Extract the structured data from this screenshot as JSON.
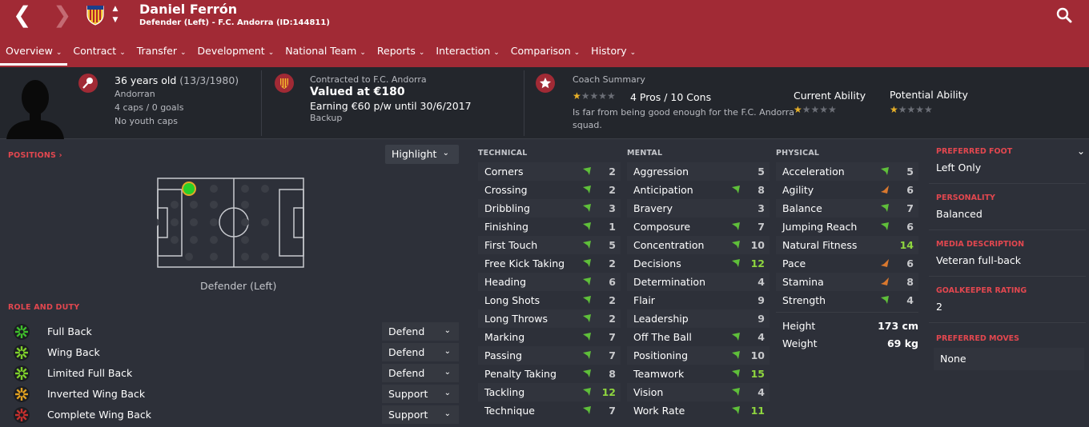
{
  "header": {
    "player_name": "Daniel Ferrón",
    "subtitle": "Defender (Left) - F.C. Andorra (ID:144811)",
    "back_glyph": "❮",
    "forward_glyph": "❯",
    "accent_color": "#a12a35"
  },
  "tabs": [
    {
      "label": "Overview"
    },
    {
      "label": "Contract"
    },
    {
      "label": "Transfer"
    },
    {
      "label": "Development"
    },
    {
      "label": "National Team"
    },
    {
      "label": "Reports"
    },
    {
      "label": "Interaction"
    },
    {
      "label": "Comparison"
    },
    {
      "label": "History"
    }
  ],
  "info": {
    "age_line_main": "36 years old",
    "age_line_dob": "(13/3/1980)",
    "nationality": "Andorran",
    "caps": "4 caps / 0 goals",
    "youth": "No youth caps",
    "contract_label": "Contracted to F.C. Andorra",
    "value": "Valued at €180",
    "wage": "Earning €60 p/w until 30/6/2017",
    "squad_status": "Backup",
    "coach_title": "Coach Summary",
    "pros_cons": "4 Pros / 10 Cons",
    "coach_text_1": "Is far from being good enough for the F.C. Andorra",
    "coach_text_2": "squad.",
    "current_ability_label": "Current Ability",
    "potential_ability_label": "Potential Ability",
    "coach_stars": 0.5,
    "current_ability_stars": 0.5,
    "potential_ability_stars": 0.5
  },
  "positions": {
    "title": "POSITIONS",
    "highlight_label": "Highlight",
    "position_label": "Defender (Left)"
  },
  "roles": {
    "title": "ROLE AND DUTY",
    "items": [
      {
        "name": "Full Back",
        "duty": "Defend",
        "color": "#3fbf2b"
      },
      {
        "name": "Wing Back",
        "duty": "Defend",
        "color": "#7fcf2b"
      },
      {
        "name": "Limited Full Back",
        "duty": "Defend",
        "color": "#7fcf2b"
      },
      {
        "name": "Inverted Wing Back",
        "duty": "Support",
        "color": "#e0a020"
      },
      {
        "name": "Complete Wing Back",
        "duty": "Support",
        "color": "#c8302e"
      }
    ]
  },
  "technical": {
    "title": "TECHNICAL",
    "items": [
      {
        "name": "Corners",
        "value": "2",
        "arrow": "up"
      },
      {
        "name": "Crossing",
        "value": "2",
        "arrow": "up"
      },
      {
        "name": "Dribbling",
        "value": "3",
        "arrow": "up"
      },
      {
        "name": "Finishing",
        "value": "1",
        "arrow": "up"
      },
      {
        "name": "First Touch",
        "value": "5",
        "arrow": "up"
      },
      {
        "name": "Free Kick Taking",
        "value": "2",
        "arrow": "up"
      },
      {
        "name": "Heading",
        "value": "6",
        "arrow": "up"
      },
      {
        "name": "Long Shots",
        "value": "2",
        "arrow": "up"
      },
      {
        "name": "Long Throws",
        "value": "2",
        "arrow": "up"
      },
      {
        "name": "Marking",
        "value": "7",
        "arrow": "up"
      },
      {
        "name": "Passing",
        "value": "7",
        "arrow": "up"
      },
      {
        "name": "Penalty Taking",
        "value": "8",
        "arrow": "up"
      },
      {
        "name": "Tackling",
        "value": "12",
        "arrow": "up"
      },
      {
        "name": "Technique",
        "value": "7",
        "arrow": "up"
      }
    ]
  },
  "mental": {
    "title": "MENTAL",
    "items": [
      {
        "name": "Aggression",
        "value": "5",
        "arrow": ""
      },
      {
        "name": "Anticipation",
        "value": "8",
        "arrow": "up"
      },
      {
        "name": "Bravery",
        "value": "3",
        "arrow": ""
      },
      {
        "name": "Composure",
        "value": "7",
        "arrow": "up"
      },
      {
        "name": "Concentration",
        "value": "10",
        "arrow": "up"
      },
      {
        "name": "Decisions",
        "value": "12",
        "arrow": "up"
      },
      {
        "name": "Determination",
        "value": "4",
        "arrow": ""
      },
      {
        "name": "Flair",
        "value": "9",
        "arrow": ""
      },
      {
        "name": "Leadership",
        "value": "9",
        "arrow": ""
      },
      {
        "name": "Off The Ball",
        "value": "4",
        "arrow": "up"
      },
      {
        "name": "Positioning",
        "value": "10",
        "arrow": "up"
      },
      {
        "name": "Teamwork",
        "value": "15",
        "arrow": "up"
      },
      {
        "name": "Vision",
        "value": "4",
        "arrow": "up"
      },
      {
        "name": "Work Rate",
        "value": "11",
        "arrow": "up"
      }
    ]
  },
  "physical": {
    "title": "PHYSICAL",
    "items": [
      {
        "name": "Acceleration",
        "value": "5",
        "arrow": "up"
      },
      {
        "name": "Agility",
        "value": "6",
        "arrow": "down"
      },
      {
        "name": "Balance",
        "value": "7",
        "arrow": "up"
      },
      {
        "name": "Jumping Reach",
        "value": "6",
        "arrow": "up"
      },
      {
        "name": "Natural Fitness",
        "value": "14",
        "arrow": ""
      },
      {
        "name": "Pace",
        "value": "6",
        "arrow": "down"
      },
      {
        "name": "Stamina",
        "value": "8",
        "arrow": "down"
      },
      {
        "name": "Strength",
        "value": "4",
        "arrow": "up"
      }
    ],
    "height_label": "Height",
    "height_value": "173 cm",
    "weight_label": "Weight",
    "weight_value": "69 kg"
  },
  "right_panel": {
    "foot_title": "PREFERRED FOOT",
    "foot_value": "Left Only",
    "personality_title": "PERSONALITY",
    "personality_value": "Balanced",
    "media_title": "MEDIA DESCRIPTION",
    "media_value": "Veteran full-back",
    "gk_title": "GOALKEEPER RATING",
    "gk_value": "2",
    "moves_title": "PREFERRED MOVES",
    "moves_value": "None"
  },
  "colors": {
    "value_low": "#c8c9cc",
    "value_high": "#8fd63f",
    "arrow_up": "#5fbf3a",
    "arrow_down": "#d9782e"
  }
}
